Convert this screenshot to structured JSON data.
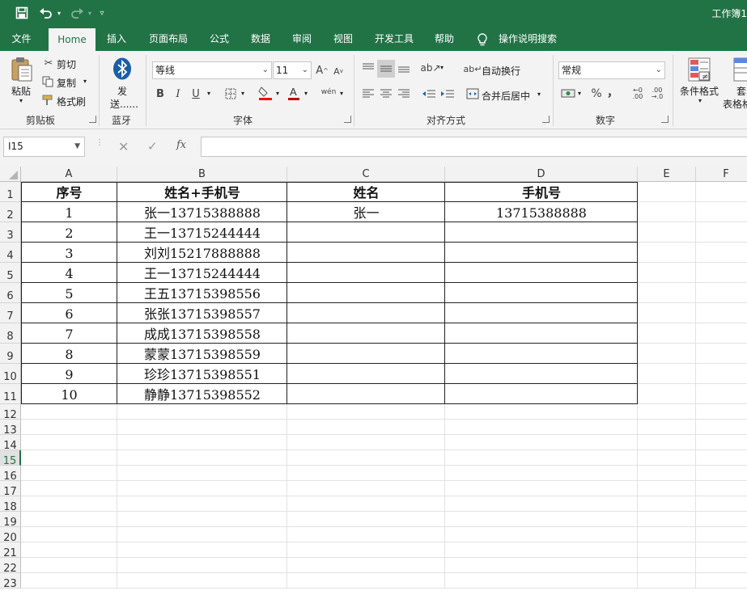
{
  "title_bar": {
    "doc_title": "工作簿1"
  },
  "tabs": [
    {
      "label": "文件",
      "active": false
    },
    {
      "label": "Home",
      "active": true
    },
    {
      "label": "插入",
      "active": false
    },
    {
      "label": "页面布局",
      "active": false
    },
    {
      "label": "公式",
      "active": false
    },
    {
      "label": "数据",
      "active": false
    },
    {
      "label": "审阅",
      "active": false
    },
    {
      "label": "视图",
      "active": false
    },
    {
      "label": "开发工具",
      "active": false
    },
    {
      "label": "帮助",
      "active": false
    }
  ],
  "tell_me": {
    "label": "操作说明搜索",
    "icon": "lightbulb-icon"
  },
  "ribbon": {
    "clipboard": {
      "paste": "粘贴",
      "cut": "剪切",
      "copy": "复制",
      "format_painter": "格式刷",
      "group_label": "剪贴板"
    },
    "bluetooth": {
      "send_1": "发",
      "send_2": "送......",
      "group_label": "蓝牙"
    },
    "font": {
      "name": "等线",
      "size": "11",
      "bold": "B",
      "italic": "I",
      "underline": "U",
      "phonetic": "wén",
      "group_label": "字体",
      "fill_color": "#ff0000",
      "font_color": "#c00000"
    },
    "alignment": {
      "wrap_text": "自动换行",
      "merge_center": "合并后居中",
      "group_label": "对齐方式"
    },
    "number": {
      "format": "常规",
      "percent": "%",
      "comma": "，",
      "group_label": "数字"
    },
    "styles": {
      "conditional": "条件格式",
      "table_1": "套",
      "table_2": "表格格"
    }
  },
  "formula_bar": {
    "name_box": "I15",
    "fx": "fx",
    "value": ""
  },
  "sheet": {
    "columns": [
      "A",
      "B",
      "C",
      "D",
      "E",
      "F"
    ],
    "row_numbers": [
      "1",
      "2",
      "3",
      "4",
      "5",
      "6",
      "7",
      "8",
      "9",
      "10",
      "11",
      "12",
      "13",
      "14",
      "15",
      "16",
      "17",
      "18",
      "19",
      "20",
      "21",
      "22",
      "23"
    ],
    "selected_row": "15",
    "header": [
      "序号",
      "姓名+手机号",
      "姓名",
      "手机号"
    ],
    "rows": [
      [
        "1",
        "张一13715388888",
        "张一",
        "13715388888"
      ],
      [
        "2",
        "王一13715244444",
        "",
        ""
      ],
      [
        "3",
        "刘刘15217888888",
        "",
        ""
      ],
      [
        "4",
        "王一13715244444",
        "",
        ""
      ],
      [
        "5",
        "王五13715398556",
        "",
        ""
      ],
      [
        "6",
        "张张13715398557",
        "",
        ""
      ],
      [
        "7",
        "成成13715398558",
        "",
        ""
      ],
      [
        "8",
        "蒙蒙13715398559",
        "",
        ""
      ],
      [
        "9",
        "珍珍13715398551",
        "",
        ""
      ],
      [
        "10",
        "静静13715398552",
        "",
        ""
      ]
    ]
  }
}
